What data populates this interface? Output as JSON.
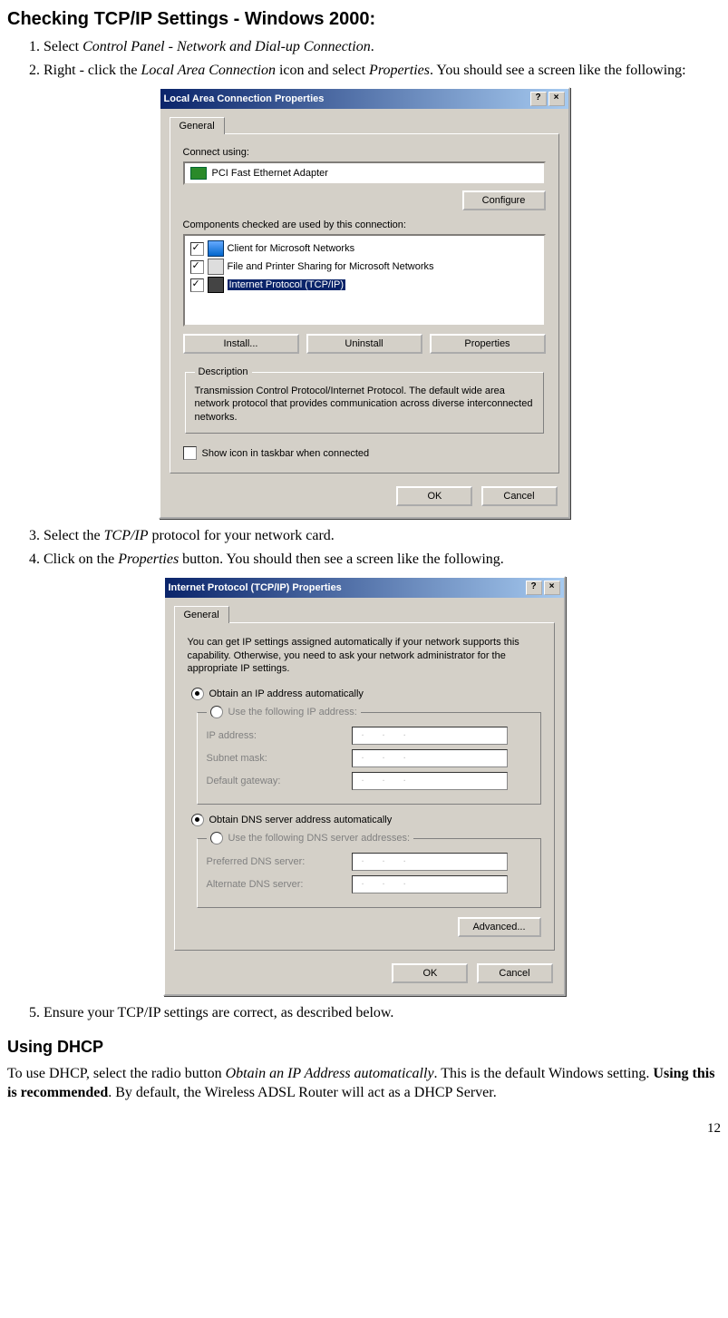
{
  "heading": "Checking TCP/IP Settings - Windows 2000:",
  "steps": {
    "s1_pre": "Select ",
    "s1_it": "Control Panel - Network and Dial-up Connection",
    "s1_post": ".",
    "s2_pre": "Right - click the ",
    "s2_it1": "Local Area Connection",
    "s2_mid": " icon and select ",
    "s2_it2": "Properties",
    "s2_post": ". You should see a screen like the following:",
    "s3_pre": "Select the ",
    "s3_it": "TCP/IP",
    "s3_post": " protocol for your network card.",
    "s4_pre": "Click on the ",
    "s4_it": "Properties",
    "s4_post": " button. You should then see a screen like the following.",
    "s5": "Ensure your TCP/IP settings are correct, as described below."
  },
  "dlg1": {
    "title": "Local Area Connection Properties",
    "tab": "General",
    "connect_using": "Connect using:",
    "adapter": "PCI Fast Ethernet Adapter",
    "configure": "Configure",
    "components_label": "Components checked are used by this connection:",
    "items": [
      "Client for Microsoft Networks",
      "File and Printer Sharing for Microsoft Networks",
      "Internet Protocol (TCP/IP)"
    ],
    "install": "Install...",
    "uninstall": "Uninstall",
    "properties": "Properties",
    "desc_legend": "Description",
    "desc_text": "Transmission Control Protocol/Internet Protocol. The default wide area network protocol that provides communication across diverse interconnected networks.",
    "show_icon": "Show icon in taskbar when connected",
    "ok": "OK",
    "cancel": "Cancel"
  },
  "dlg2": {
    "title": "Internet Protocol (TCP/IP) Properties",
    "tab": "General",
    "info": "You can get IP settings assigned automatically if your network supports this capability. Otherwise, you need to ask your network administrator for the appropriate IP settings.",
    "r_obtain_ip": "Obtain an IP address automatically",
    "r_use_ip": "Use the following IP address:",
    "ip_address": "IP address:",
    "subnet": "Subnet mask:",
    "gateway": "Default gateway:",
    "r_obtain_dns": "Obtain DNS server address automatically",
    "r_use_dns": "Use the following DNS server addresses:",
    "pref_dns": "Preferred DNS server:",
    "alt_dns": "Alternate DNS server:",
    "advanced": "Advanced...",
    "ok": "OK",
    "cancel": "Cancel",
    "ip_dots": "..."
  },
  "dhcp": {
    "heading": "Using DHCP",
    "p_pre": "To use DHCP, select the radio button ",
    "p_it": "Obtain an IP Address automatically",
    "p_mid": ". This is the default Windows setting. ",
    "p_bold": "Using this is recommended",
    "p_post": ". By default, the Wireless ADSL Router will act as a DHCP Server."
  },
  "page_num": "12"
}
